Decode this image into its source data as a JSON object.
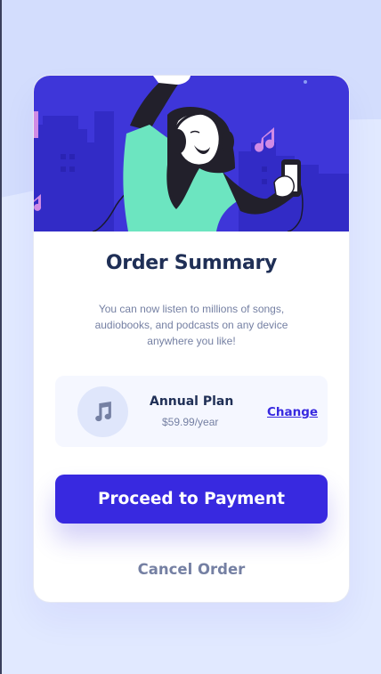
{
  "summary": {
    "title": "Order Summary",
    "description": "You can now listen to millions of songs, audiobooks, and podcasts on any device anywhere you like!"
  },
  "plan": {
    "name": "Annual Plan",
    "price": "$59.99/year",
    "change_label": "Change",
    "icon": "music-note-icon"
  },
  "actions": {
    "proceed_label": "Proceed to Payment",
    "cancel_label": "Cancel Order"
  },
  "colors": {
    "background": "#e1e9ff",
    "accent": "#3829e0",
    "dark_text": "#1f2f56",
    "muted_text": "#7580a3",
    "plan_box": "#f5f7ff",
    "hero_bg": "#3e36d9"
  }
}
